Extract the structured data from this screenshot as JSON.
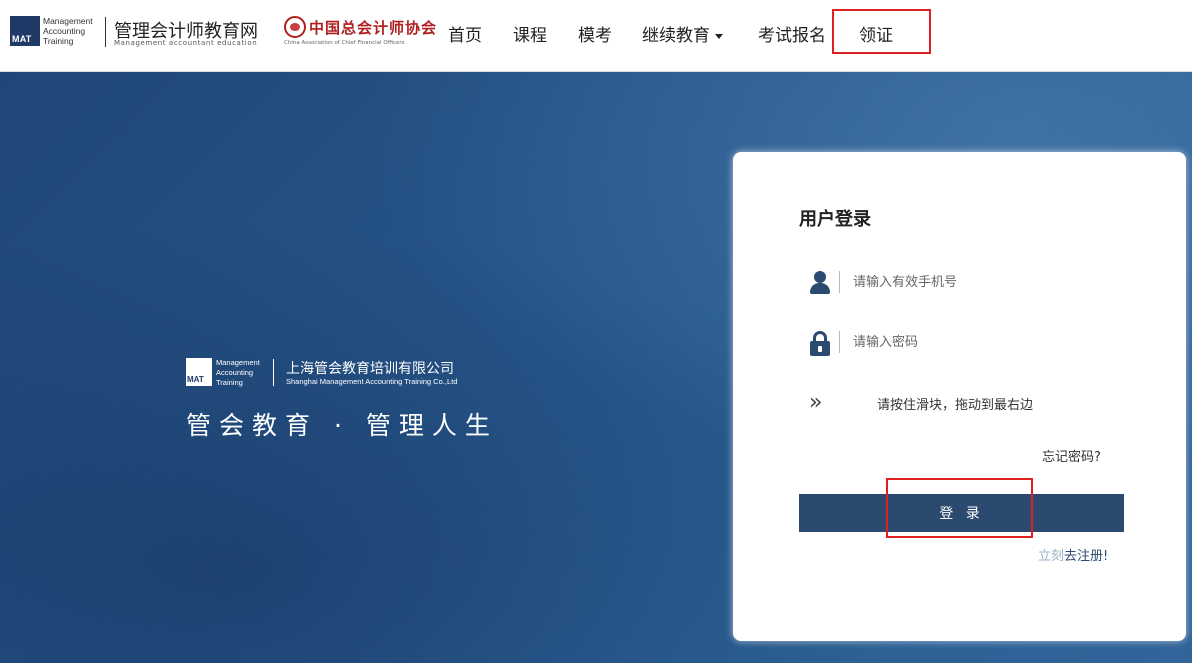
{
  "header": {
    "mat_logo": {
      "abbr": "MAT",
      "lines": [
        "Management",
        "Accounting",
        "Training"
      ]
    },
    "brand_cn": "管理会计师教育网",
    "brand_en": "Management accountant education",
    "partner_cn": "中国总会计师协会",
    "partner_en": "China Association of Chief Financial Officers",
    "nav": {
      "home": "首页",
      "courses": "课程",
      "mock_exam": "模考",
      "continuing_education": "继续教育",
      "exam_registration": "考试报名",
      "certificate": "领证"
    }
  },
  "hero": {
    "company_logo": {
      "abbr": "MAT",
      "lines": [
        "Management",
        "Accounting",
        "Training"
      ],
      "name_cn": "上海管会教育培训有限公司",
      "name_en": "Shanghai Management Accounting Training Co.,Ltd"
    },
    "slogan": "管会教育 · 管理人生"
  },
  "login": {
    "title": "用户登录",
    "phone_placeholder": "请输入有效手机号",
    "password_placeholder": "请输入密码",
    "slider_hint": "请按住滑块，拖动到最右边",
    "slider_handle": "»",
    "forgot_password": "忘记密码?",
    "submit_label": "登 录",
    "register_prefix": "立刻",
    "register_link": "去注册!"
  },
  "colors": {
    "primary": "#2b4a70",
    "highlight": "#e02020",
    "hero_bg": "#27568a"
  }
}
